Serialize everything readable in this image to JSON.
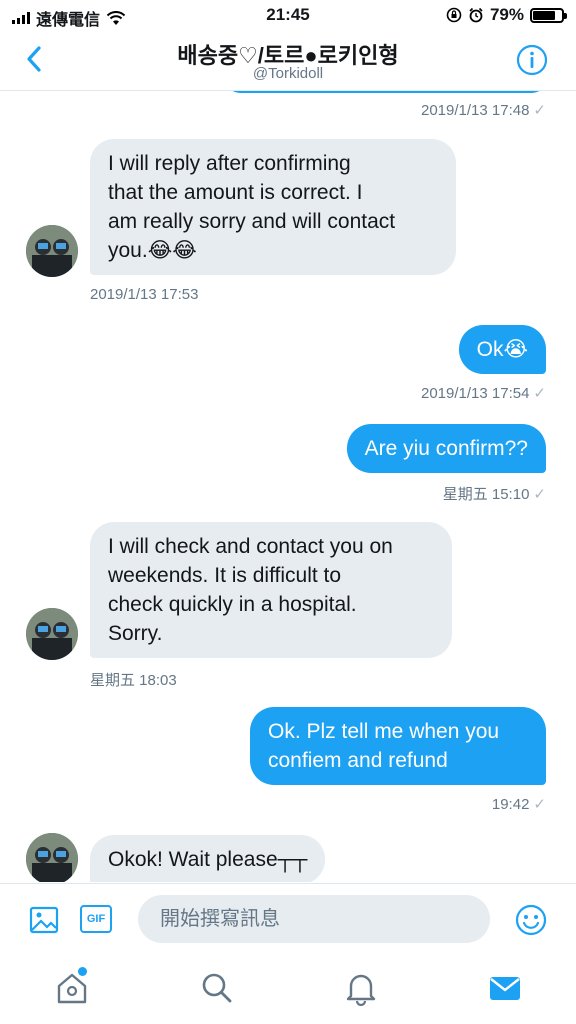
{
  "status_bar": {
    "carrier": "遠傳電信",
    "time": "21:45",
    "battery": "79%",
    "battery_level": 0.79
  },
  "header": {
    "title": "배송중♡/토르●로키인형",
    "handle": "@Torkidoll"
  },
  "messages": [
    {
      "direction": "in",
      "lines": [
        "I will reply after confirming",
        "that the amount is correct. I",
        "am really sorry and will contact",
        "you.😂😂"
      ],
      "timestamp": "2019/1/13 17:53"
    },
    {
      "direction": "out",
      "lines": [
        "Ok😭"
      ],
      "timestamp": "2019/1/13 17:54"
    },
    {
      "direction": "out",
      "lines": [
        "Are yiu confirm??"
      ],
      "timestamp": "星期五 15:10"
    },
    {
      "direction": "in",
      "lines": [
        "I will check and contact you on",
        "weekends. It is difficult to",
        "check quickly in a hospital.",
        "Sorry."
      ],
      "timestamp": "星期五 18:03"
    },
    {
      "direction": "out",
      "lines": [
        "Ok. Plz tell me when you",
        "confiem and refund"
      ],
      "timestamp": "19:42"
    },
    {
      "direction": "in",
      "lines": [
        "Okok! Wait please┬┬"
      ],
      "timestamp": ""
    }
  ],
  "previous_message": {
    "timestamp": "2019/1/13 17:48"
  },
  "composer": {
    "placeholder": "開始撰寫訊息"
  },
  "colors": {
    "accent": "#1da1f2",
    "incoming_bubble": "#e6ecf0",
    "secondary_text": "#657786"
  },
  "icons": [
    "back-icon",
    "info-icon",
    "image-icon",
    "gif-icon",
    "emoji-icon",
    "home-icon",
    "search-icon",
    "bell-icon",
    "mail-icon"
  ]
}
